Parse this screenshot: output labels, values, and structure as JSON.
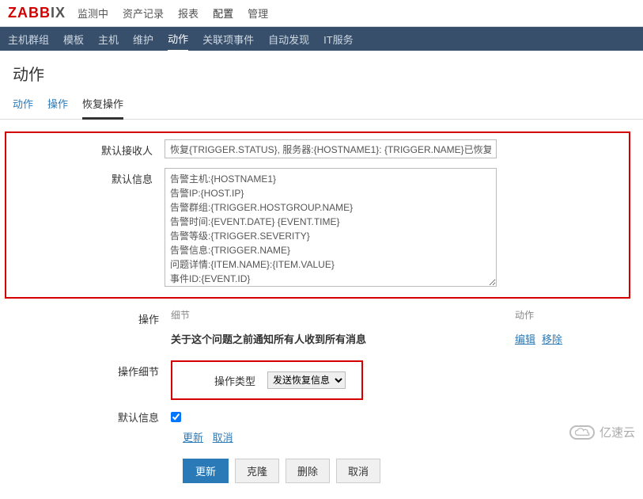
{
  "logo": {
    "part1": "ZABB",
    "part2": "IX"
  },
  "topMenu": {
    "items": [
      "监测中",
      "资产记录",
      "报表",
      "配置",
      "管理"
    ],
    "activeIndex": 3
  },
  "subMenu": {
    "items": [
      "主机群组",
      "模板",
      "主机",
      "维护",
      "动作",
      "关联项事件",
      "自动发现",
      "IT服务"
    ],
    "activeIndex": 4
  },
  "pageTitle": "动作",
  "tabs": {
    "items": [
      "动作",
      "操作",
      "恢复操作"
    ],
    "activeIndex": 2
  },
  "form": {
    "defaultRecipientLabel": "默认接收人",
    "defaultRecipientValue": "恢复{TRIGGER.STATUS}, 服务器:{HOSTNAME1}: {TRIGGER.NAME}已恢复",
    "defaultMessageLabel": "默认信息",
    "defaultMessageValue": "告警主机:{HOSTNAME1}\n告警IP:{HOST.IP}\n告警群组:{TRIGGER.HOSTGROUP.NAME}\n告警时间:{EVENT.DATE} {EVENT.TIME}\n告警等级:{TRIGGER.SEVERITY}\n告警信息:{TRIGGER.NAME}\n问题详情:{ITEM.NAME}:{ITEM.VALUE}\n事件ID:{EVENT.ID}\n--------------------------------------------------------------------",
    "operationsLabel": "操作",
    "opsHeader": {
      "detail": "细节",
      "action": "动作"
    },
    "opsRow": {
      "detail": "关于这个问题之前通知所有人收到所有消息",
      "edit": "编辑",
      "remove": "移除"
    },
    "opDetailLabel": "操作细节",
    "opTypeLabel": "操作类型",
    "opTypeSelected": "发送恢复信息",
    "defaultInfoLabel": "默认信息",
    "defaultInfoChecked": true,
    "updateLink": "更新",
    "cancelLink": "取消"
  },
  "buttons": {
    "update": "更新",
    "clone": "克隆",
    "delete": "删除",
    "cancel": "取消"
  },
  "watermark": "亿速云"
}
